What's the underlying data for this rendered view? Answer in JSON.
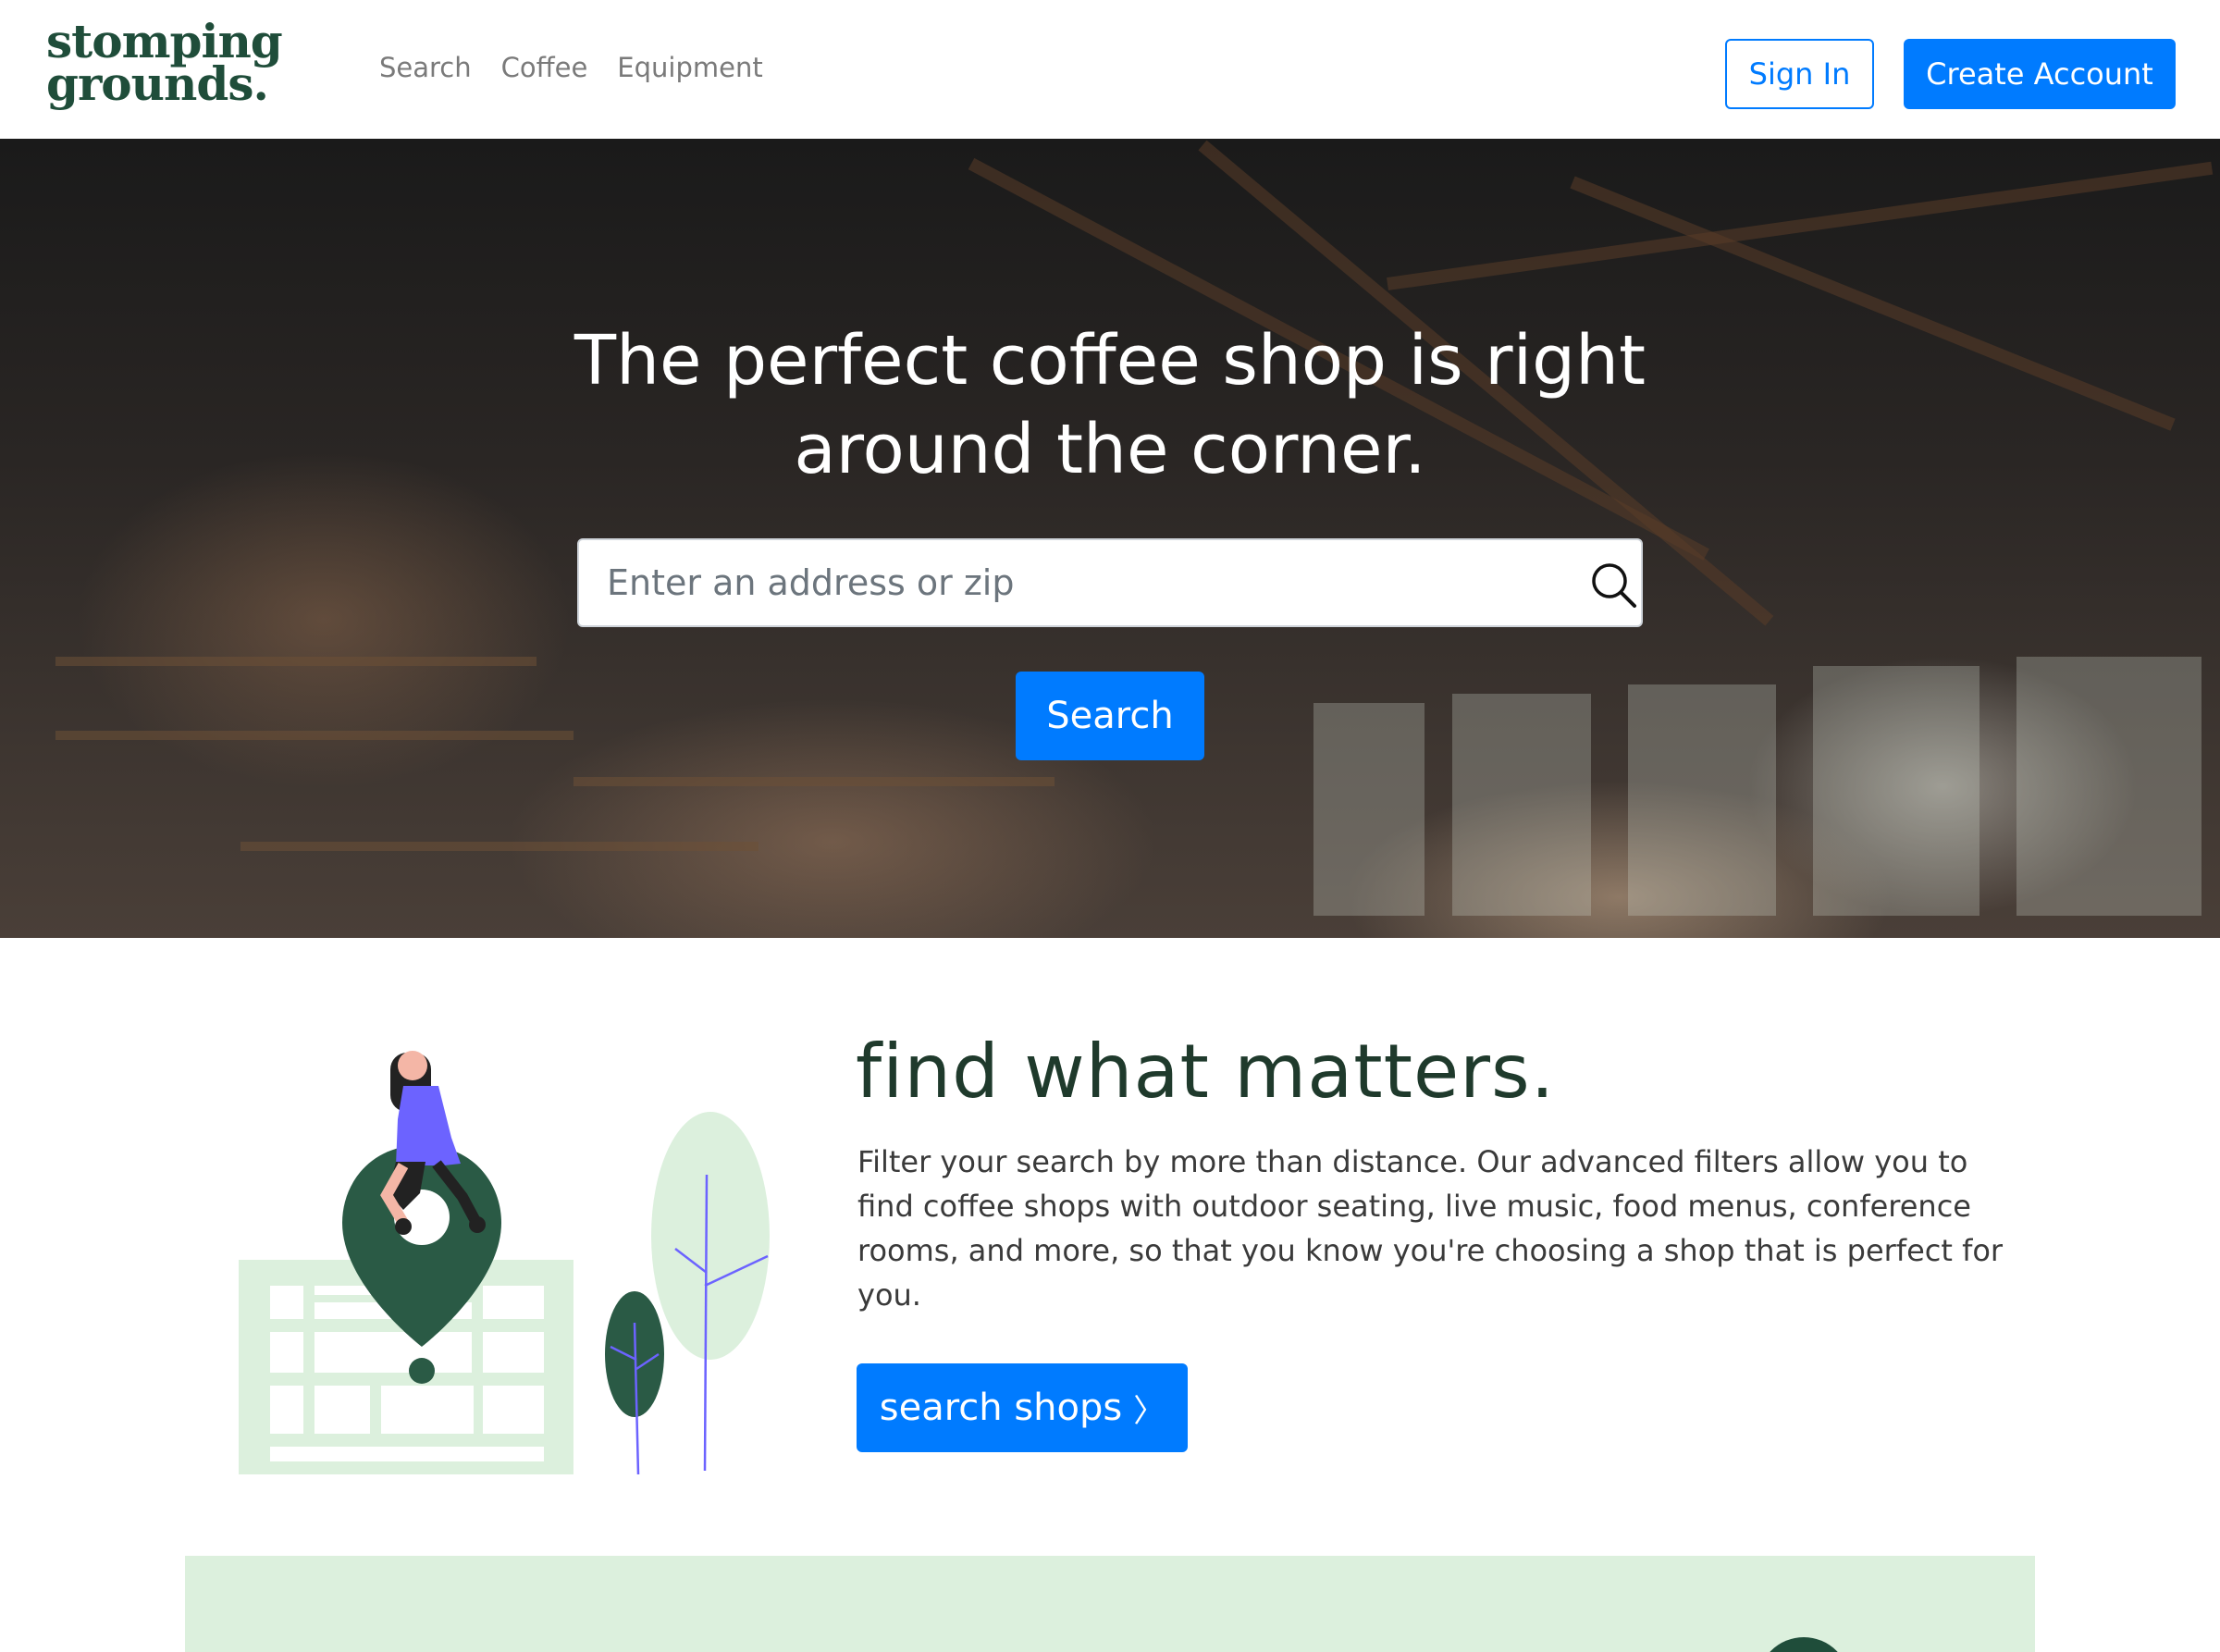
{
  "brand": {
    "logo_line1": "stomping",
    "logo_line2": "grounds."
  },
  "nav": {
    "links": [
      "Search",
      "Coffee",
      "Equipment"
    ],
    "signin_label": "Sign In",
    "create_account_label": "Create Account"
  },
  "hero": {
    "title": "The perfect coffee shop is right around the corner.",
    "search_placeholder": "Enter an address or zip",
    "search_button_label": "Search"
  },
  "feature": {
    "heading": "find what matters.",
    "body": "Filter your search by more than distance. Our advanced filters allow you to find coffee shops with outdoor seating, live music, food menus, conference rooms, and more, so that you know you're choosing a shop that is perfect for you.",
    "button_label": "search shops",
    "button_chevron": "〉"
  },
  "colors": {
    "primary": "#007bff",
    "brand_green": "#1f4d3a",
    "light_green": "#dcf0dd",
    "accent_purple": "#6c63ff"
  },
  "icons": {
    "search": "search-icon",
    "chevron": "chevron-right-icon"
  }
}
